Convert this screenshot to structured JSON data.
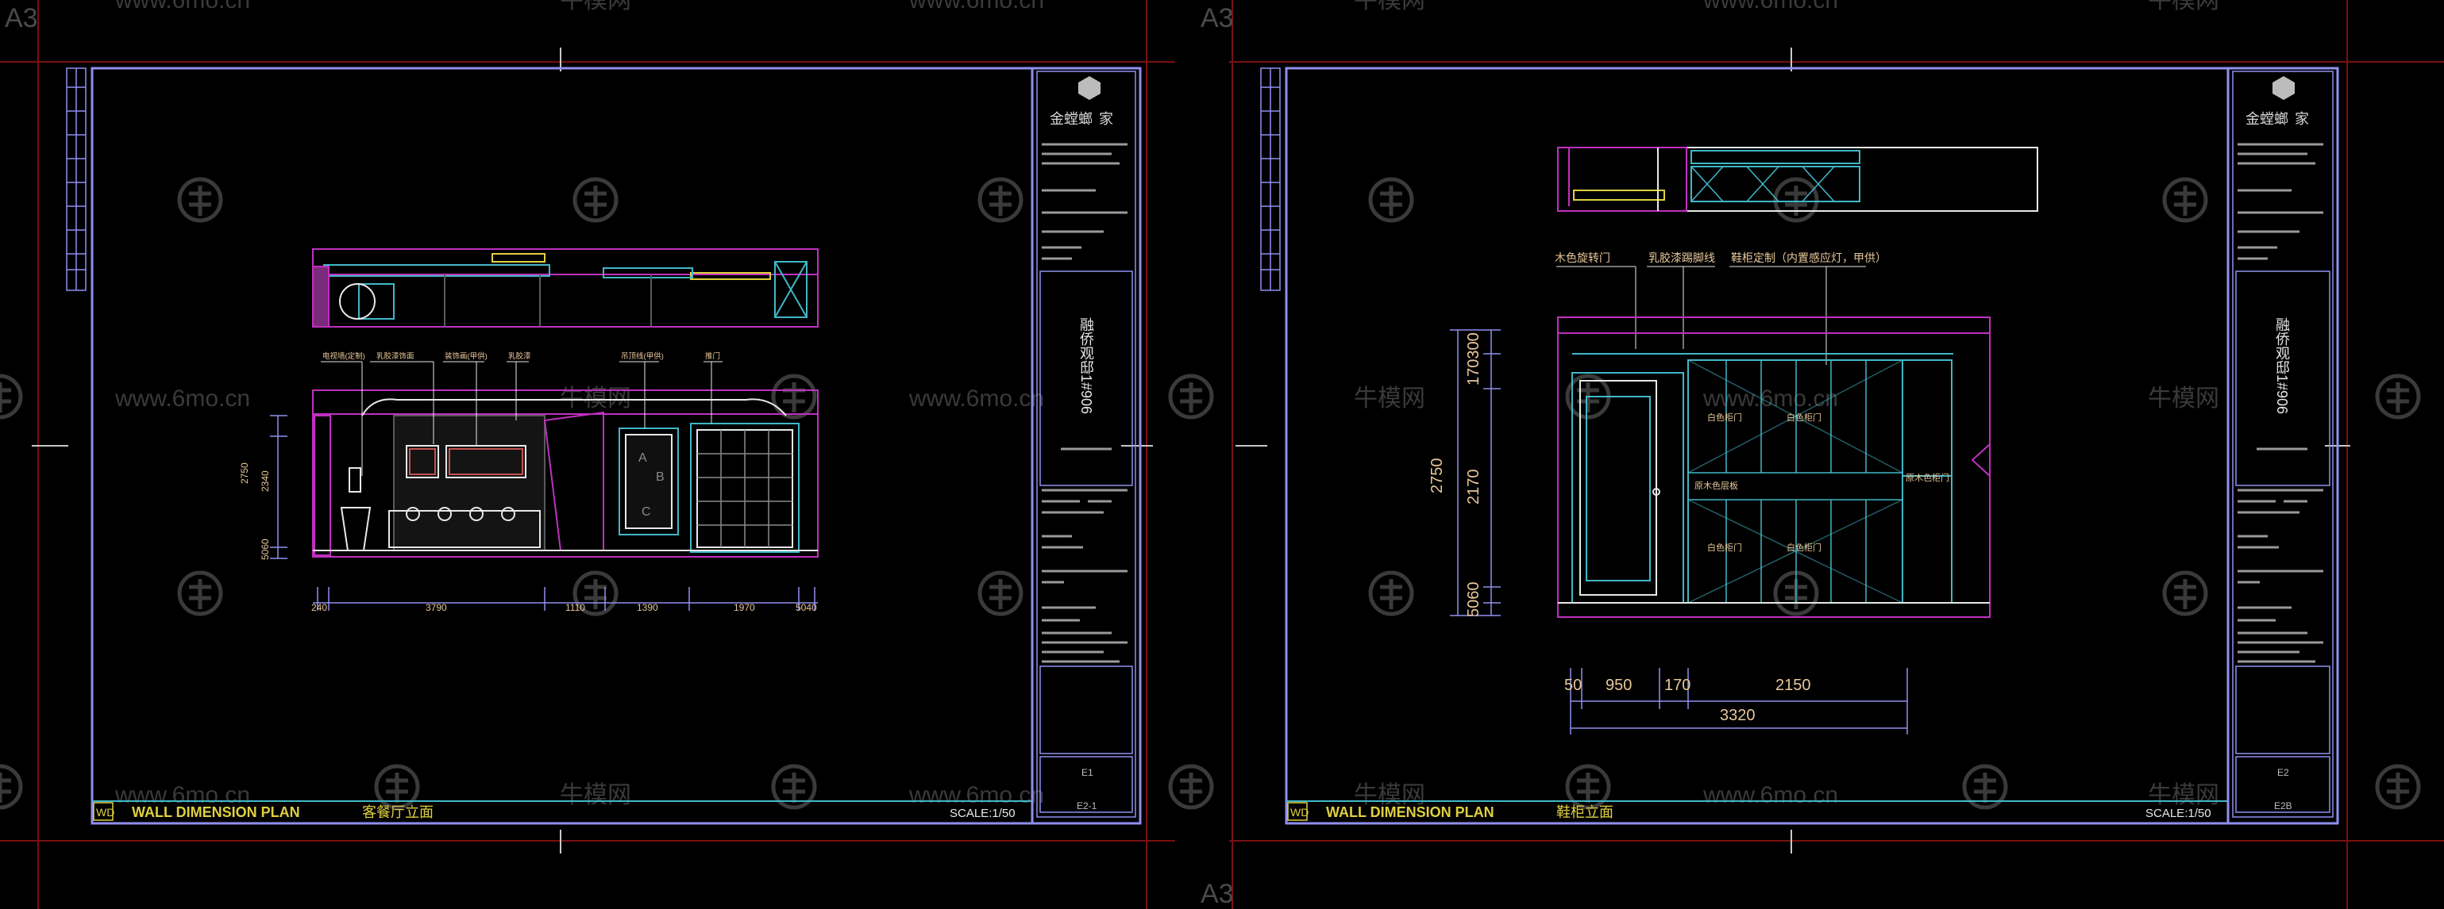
{
  "watermark": {
    "site": "www.6mo.cn",
    "brand": "牛模网",
    "sheet_size": "A3"
  },
  "colors": {
    "background": "#000000",
    "frame": "#8f8ff0",
    "sheet_edge": "#7a1010",
    "magenta": "#c030c0",
    "cyan": "#40b8c8",
    "yellow": "#e0d040",
    "white": "#e8e8e8",
    "dim": "#5a5a5a",
    "label": "#e8c89a"
  },
  "sheets": [
    {
      "title_block": {
        "logo_text": "金螳螂",
        "logo_suffix": "家",
        "project_vertical": "融侨观邸1#906",
        "drawing_no": "E1",
        "page": "E2-1"
      },
      "footer": {
        "tag": "WD",
        "plan_name": "WALL DIMENSION PLAN",
        "view_name": "客餐厅立面",
        "scale": "SCALE:1/50"
      },
      "labels": [
        "电视墙(定制)",
        "乳胶漆饰面",
        "装饰画(甲供)",
        "乳胶漆",
        "吊顶线(甲供)",
        "推门"
      ],
      "dims_bottom": [
        "240",
        "3790",
        "1110",
        "1390",
        "1970",
        "5040"
      ],
      "dims_left": [
        "2750",
        "2340",
        "5060"
      ],
      "panel_letters": [
        "A",
        "B",
        "C"
      ]
    },
    {
      "title_block": {
        "logo_text": "金螳螂",
        "logo_suffix": "家",
        "project_vertical": "融侨观邸1#906",
        "drawing_no": "E2",
        "page": "E2B"
      },
      "footer": {
        "tag": "WD",
        "plan_name": "WALL DIMENSION PLAN",
        "view_name": "鞋柜立面",
        "scale": "SCALE:1/50"
      },
      "labels": [
        "木色旋转门",
        "乳胶漆踢脚线",
        "鞋柜定制（内置感应灯，甲供）"
      ],
      "cabinet_labels": [
        "白色柜门",
        "白色柜门",
        "原木色层板",
        "原木色柜门",
        "白色柜门",
        "白色柜门"
      ],
      "dims_left": [
        "2750",
        "170300",
        "2170",
        "5060"
      ],
      "dims_bottom": [
        "50",
        "950",
        "170",
        "2150"
      ],
      "dim_total": "3320"
    }
  ]
}
